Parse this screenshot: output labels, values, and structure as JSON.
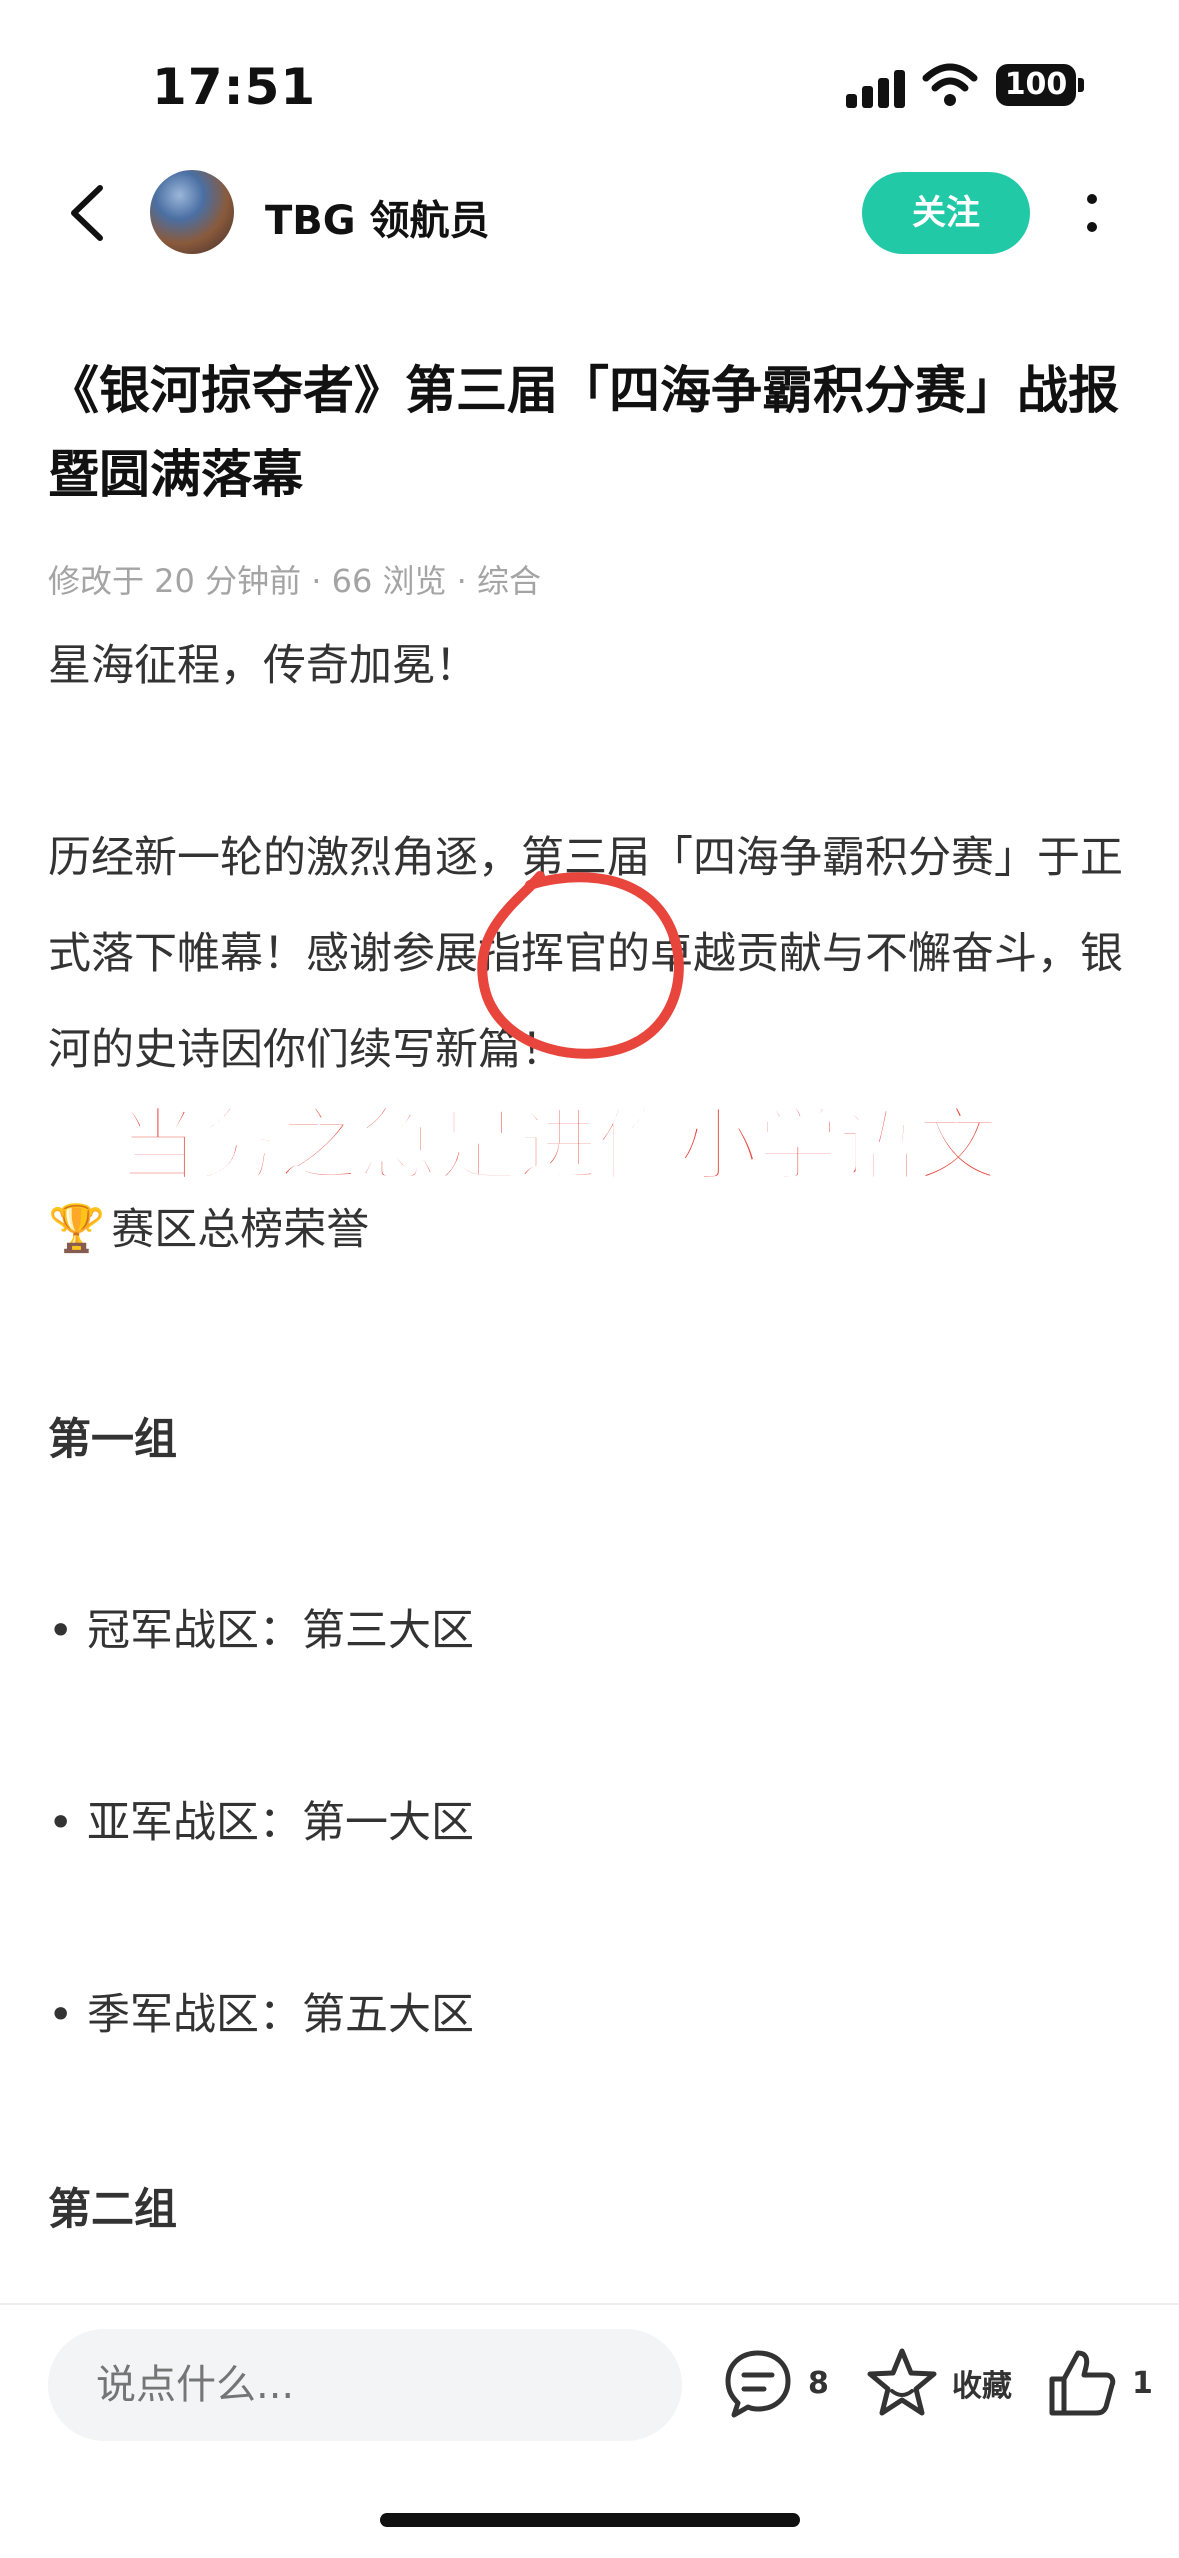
{
  "status_bar": {
    "time": "17:51",
    "battery": "100"
  },
  "header": {
    "author": "TBG 领航员",
    "follow_label": "关注"
  },
  "article": {
    "title": "《银河掠夺者》第三届「四海争霸积分赛」战报暨圆满落幕",
    "meta": "修改于 20 分钟前 · 66 浏览 · 综合",
    "para1": "星海征程，传奇加冕！",
    "para2": "历经新一轮的激烈角逐，第三届「四海争霸积分赛」于正式落下帷幕！感谢参展指挥官的卓越贡献与不懈奋斗，银河的史诗因你们续写新篇！",
    "honor_emoji": "🏆",
    "honor": "赛区总榜荣誉",
    "group1": "第一组",
    "bullets": [
      "• 冠军战区：第三大区",
      "• 亚军战区：第一大区",
      "• 季军战区：第五大区"
    ],
    "group2": "第二组"
  },
  "overlay": {
    "text": "当务之急是进修小学语文",
    "color": "#e8453c"
  },
  "bottom_bar": {
    "comment_placeholder": "说点什么...",
    "comment_count": "8",
    "collect_label": "收藏",
    "like_count": "1"
  },
  "colors": {
    "accent": "#22c9a7",
    "annotation": "#e8453c"
  }
}
